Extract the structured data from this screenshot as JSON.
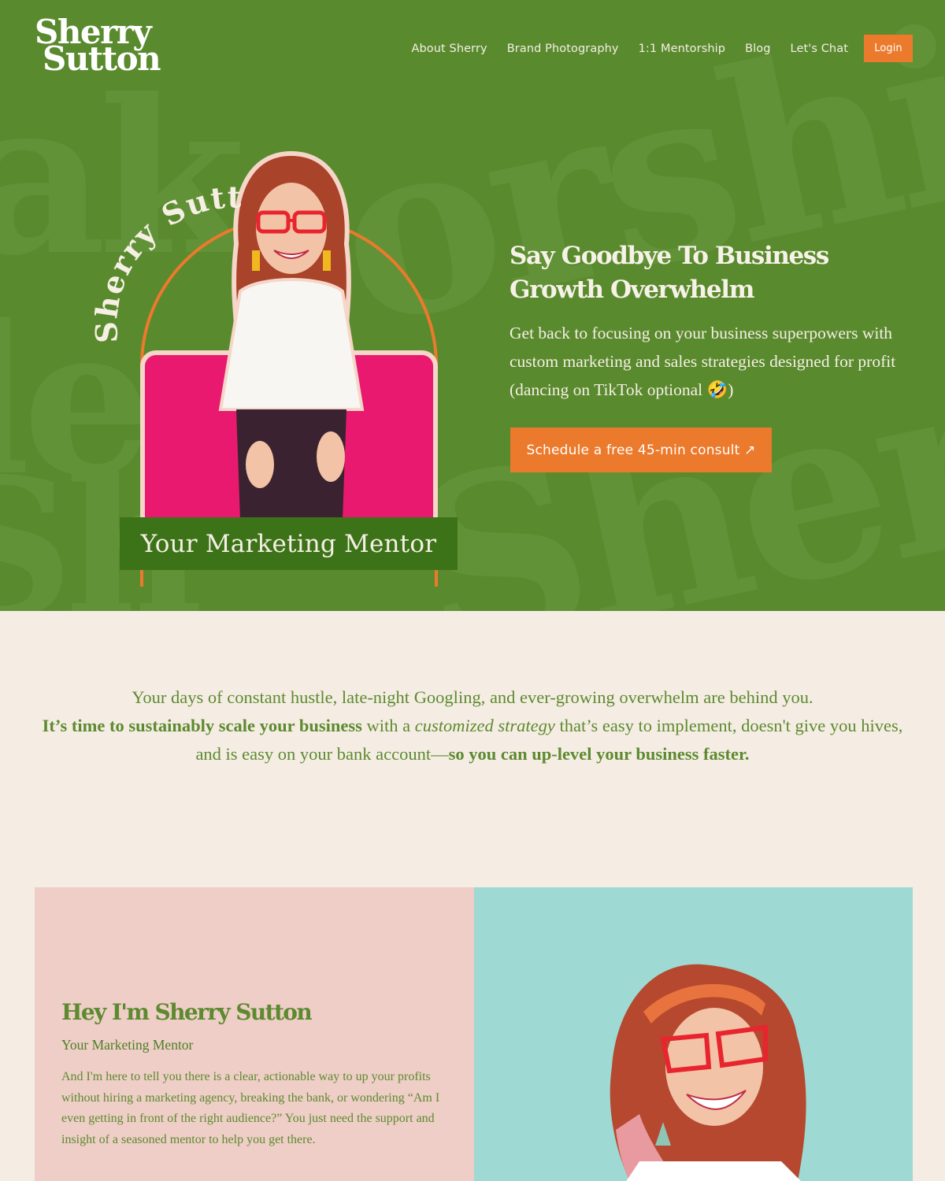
{
  "header": {
    "logo_line1": "Sherry",
    "logo_line2": "Sutton",
    "nav": [
      {
        "label": "About Sherry"
      },
      {
        "label": "Brand Photography"
      },
      {
        "label": "1:1 Mentorship"
      },
      {
        "label": "Blog"
      },
      {
        "label": "Let's Chat"
      }
    ],
    "login_label": "Login"
  },
  "hero": {
    "background_watermark": "Mentorship Sherry",
    "arc_text": "Sherry Sutton",
    "banner": "Your Marketing Mentor",
    "title": "Say Goodbye To Business Growth Overwhelm",
    "subtitle": "Get back to focusing on your business superpowers with custom marketing and sales strategies designed for profit (dancing on TikTok optional 🤣)",
    "cta_label": "Schedule a free 45-min consult ↗"
  },
  "intro": {
    "line1": "Your days of constant hustle, late-night Googling, and ever-growing overwhelm are behind you.",
    "line2_bold": "It’s time to sustainably scale your business",
    "line2_mid": " with a ",
    "line2_italic": "customized strategy",
    "line2_end": " that’s easy to implement, doesn't give you hives,",
    "line3_start": "and is easy on your bank account—",
    "line3_bold": "so you can up-level your business faster."
  },
  "about": {
    "title": "Hey I'm Sherry Sutton",
    "subtitle": "Your Marketing Mentor",
    "body": "And I'm here to tell you there is a clear, actionable way to up your profits without hiring a marketing agency, breaking the bank, or wondering “Am I even getting in front of the right audience?” You just need the support and insight of a seasoned mentor to help you get there."
  },
  "colors": {
    "hero_green": "#5a8a2e",
    "banner_green": "#3d7318",
    "accent_orange": "#ec7a2c",
    "cream": "#f5ede3",
    "pink_panel": "#eecec6",
    "teal_panel": "#9ed9d3",
    "text_green": "#5d8a30"
  }
}
